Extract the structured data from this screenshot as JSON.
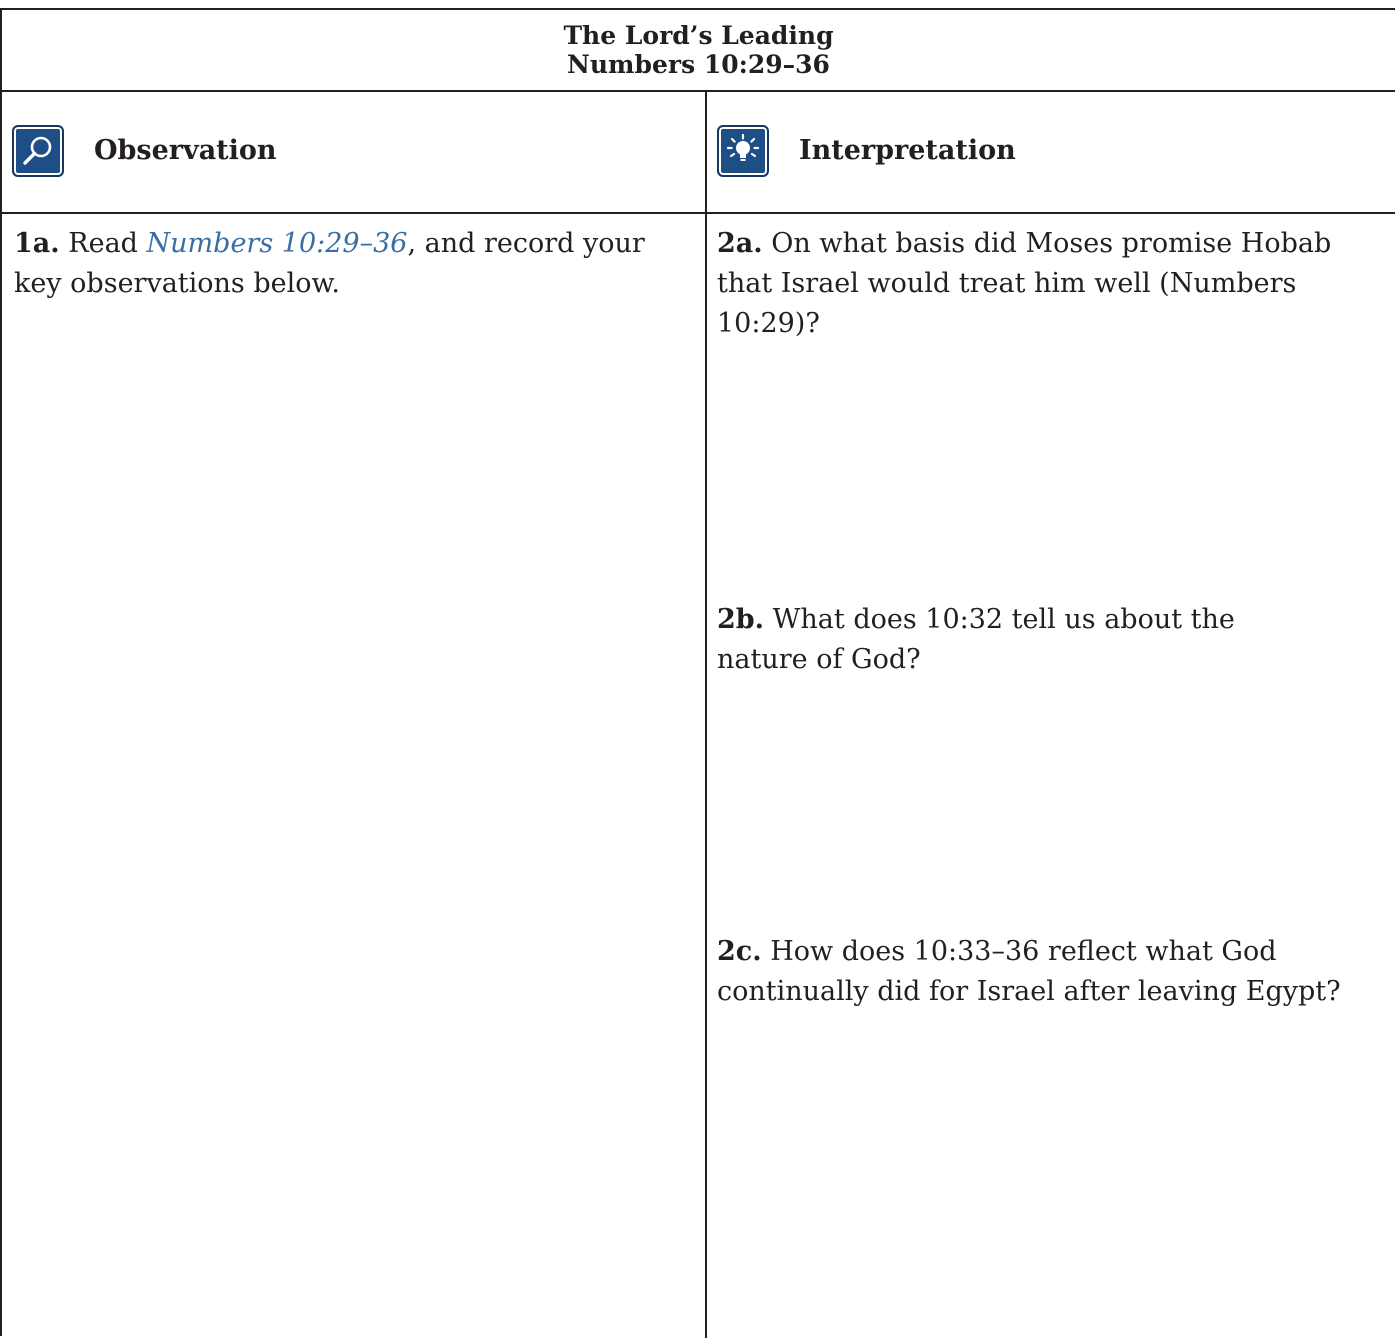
{
  "title": {
    "line1": "The Lord’s Leading",
    "line2": "Numbers 10:29–36"
  },
  "observation": {
    "heading": "Observation",
    "icon": "magnifier-icon",
    "question_1a": {
      "number": "1a.",
      "text_before": " Read ",
      "reference": "Numbers 10:29–36",
      "text_after": ", and record your key observations below."
    }
  },
  "interpretation": {
    "heading": "Interpretation",
    "icon": "lightbulb-icon",
    "question_2a": {
      "number": "2a.",
      "text": " On what basis did Moses promise Hobab that Israel would treat him well (Numbers 10:29)?"
    },
    "question_2b": {
      "number": "2b.",
      "text": " What does 10:32 tell us about the nature of God?"
    },
    "question_2c": {
      "number": "2c.",
      "text": " How does 10:33–36 reflect what God continually did for Israel after leaving Egypt?"
    }
  },
  "colors": {
    "icon_fill": "#1d4f86",
    "reference_link": "#3a6ea5",
    "rule": "#231f20"
  }
}
